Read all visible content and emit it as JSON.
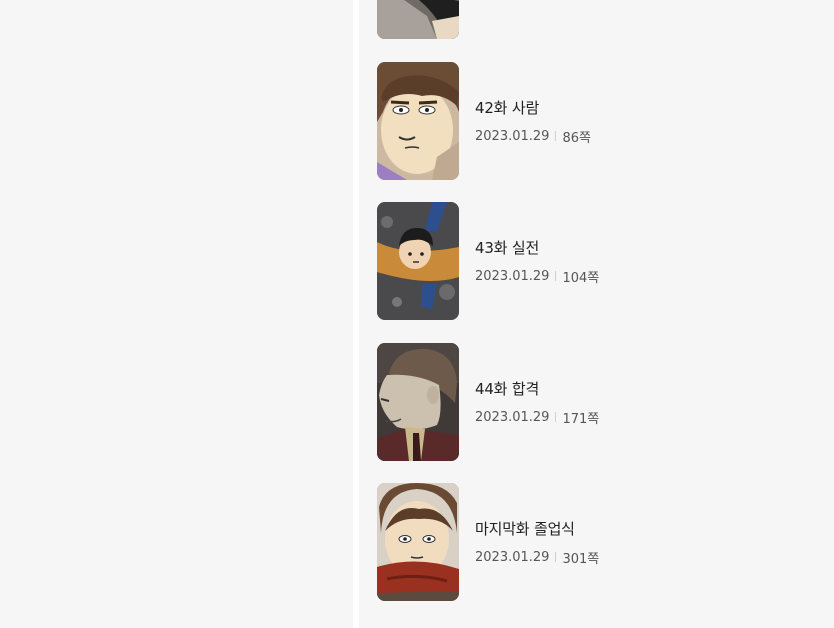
{
  "episodes": [
    {
      "title": "",
      "date": "",
      "pages": "",
      "thumb": "partial-episode-thumbnail"
    },
    {
      "title": "42화 사람",
      "date": "2023.01.29",
      "pages": "86쪽",
      "thumb": "boy-face-thumbnail"
    },
    {
      "title": "43화 실전",
      "date": "2023.01.29",
      "pages": "104쪽",
      "thumb": "boy-flying-thumbnail"
    },
    {
      "title": "44화 합격",
      "date": "2023.01.29",
      "pages": "171쪽",
      "thumb": "old-man-profile-thumbnail"
    },
    {
      "title": "마지막화 졸업식",
      "date": "2023.01.29",
      "pages": "301쪽",
      "thumb": "boy-scarf-thumbnail"
    }
  ]
}
